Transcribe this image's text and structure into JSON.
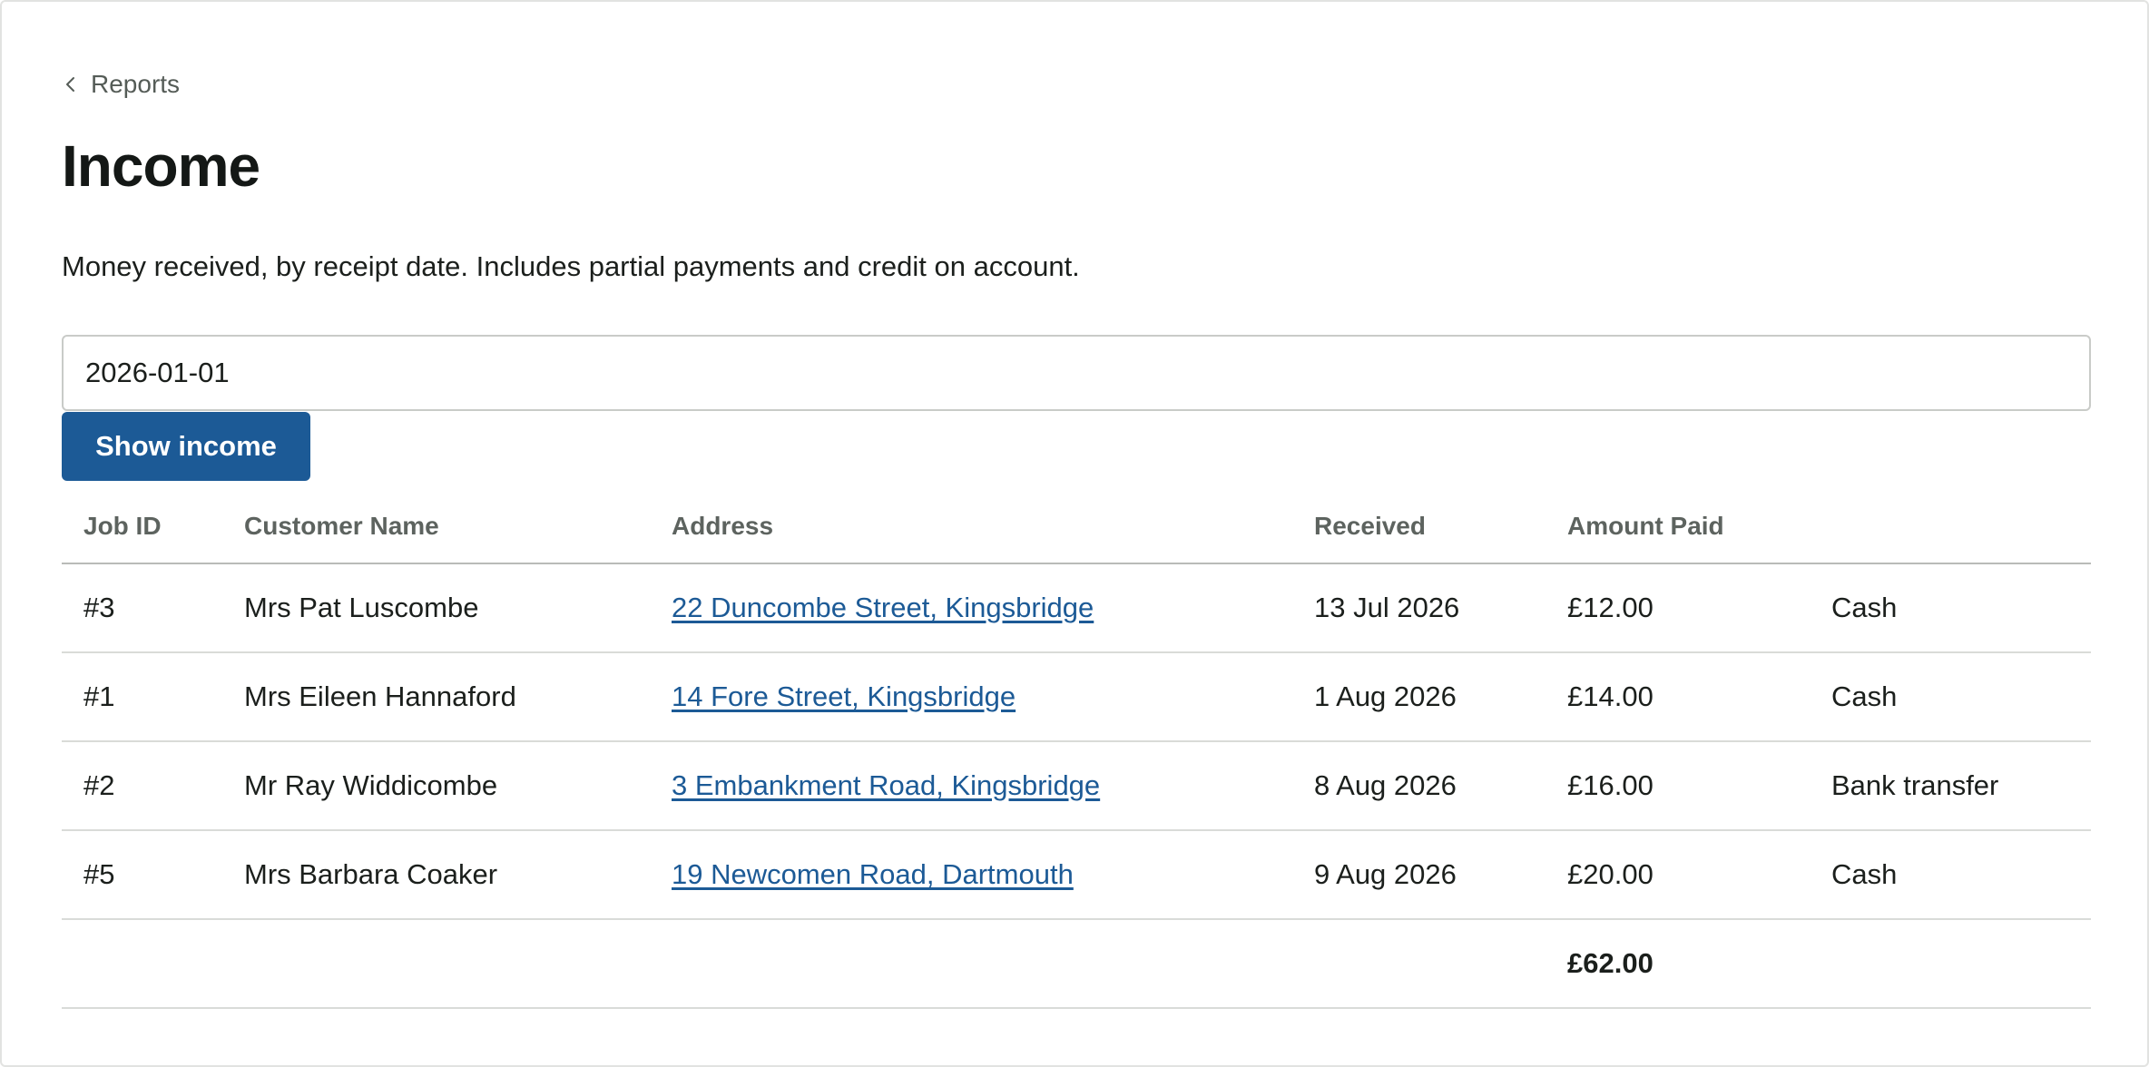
{
  "breadcrumb": {
    "label": "Reports"
  },
  "page": {
    "title": "Income",
    "subtitle": "Money received, by receipt date. Includes partial payments and credit on account."
  },
  "filter": {
    "date_value": "2026-01-01",
    "button_label": "Show income"
  },
  "table": {
    "headers": {
      "job_id": "Job ID",
      "customer": "Customer Name",
      "address": "Address",
      "received": "Received",
      "amount": "Amount Paid",
      "method": ""
    },
    "rows": [
      {
        "job_id": "#3",
        "customer": "Mrs Pat Luscombe",
        "address": "22 Duncombe Street, Kingsbridge",
        "received": "13 Jul 2026",
        "amount": "£12.00",
        "method": "Cash"
      },
      {
        "job_id": "#1",
        "customer": "Mrs Eileen Hannaford",
        "address": "14 Fore Street, Kingsbridge",
        "received": "1 Aug 2026",
        "amount": "£14.00",
        "method": "Cash"
      },
      {
        "job_id": "#2",
        "customer": "Mr Ray Widdicombe",
        "address": "3 Embankment Road, Kingsbridge",
        "received": "8 Aug 2026",
        "amount": "£16.00",
        "method": "Bank transfer"
      },
      {
        "job_id": "#5",
        "customer": "Mrs Barbara Coaker",
        "address": "19 Newcomen Road, Dartmouth",
        "received": "9 Aug 2026",
        "amount": "£20.00",
        "method": "Cash"
      }
    ],
    "total": "£62.00"
  },
  "colors": {
    "primary": "#1c5a96",
    "text": "#1b1f1c",
    "muted": "#5d635f"
  }
}
